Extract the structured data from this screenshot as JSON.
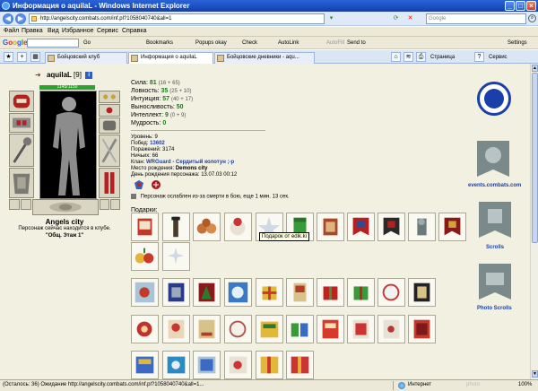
{
  "window": {
    "title": "Информация о aquilaL - Windows Internet Explorer",
    "minimize": "_",
    "maximize": "□",
    "close": "×"
  },
  "address": {
    "url": "http://angelscity.combats.com/inf.pl?1058040740&all=1",
    "search_placeholder": "Google"
  },
  "menu": [
    "Файл",
    "Правка",
    "Вид",
    "Избранное",
    "Сервис",
    "Справка"
  ],
  "google_toolbar": {
    "go": "Go",
    "bookmarks": "Bookmarks",
    "popups": "Popups okay",
    "check": "Check",
    "autolink": "AutoLink",
    "autofill": "AutoFill",
    "sendto": "Send to",
    "settings": "Settings"
  },
  "tabs": [
    {
      "label": "Бойцовский клуб",
      "active": false
    },
    {
      "label": "Информация о aquilaL",
      "active": true
    },
    {
      "label": "Бойцовские дневники - aqu...",
      "active": false
    }
  ],
  "tabbar_right": {
    "page": "Страница",
    "tools": "Сервис"
  },
  "character": {
    "name": "aquilaL",
    "level": "[9]",
    "badge": "i",
    "hp": "1145/1150",
    "city": "Angels city",
    "status": "Персонаж сейчас находится в клубе.",
    "room": "\"Общ. Этаж 1\""
  },
  "stats": [
    {
      "label": "Сила:",
      "value": "81",
      "extra": "(16 + 65)"
    },
    {
      "label": "Ловкость:",
      "value": "35",
      "extra": "(25 + 10)"
    },
    {
      "label": "Интуиция:",
      "value": "57",
      "extra": "(40 + 17)"
    },
    {
      "label": "Выносливость:",
      "value": "50",
      "extra": ""
    },
    {
      "label": "Интеллект:",
      "value": "9",
      "extra": "(0 + 9)"
    },
    {
      "label": "Мудрость:",
      "value": "0",
      "extra": ""
    }
  ],
  "info": {
    "level": "Уровень: 9",
    "wins_label": "Побед:",
    "wins": "13602",
    "losses": "Поражений: 3174",
    "draws": "Ничьих: 66",
    "clan_label": "Клан:",
    "clan": "WRGuard - Сердитый колотун ;-p",
    "birthplace_label": "Место рождения:",
    "birthplace": "Demons city",
    "birthday": "День рождения персонажа: 13.07.03 00:12"
  },
  "weakness": "Персонаж ослаблен из-за смерти в бою, еще 1 мин. 13 сек.",
  "gifts": {
    "title": "Подарки:",
    "tooltip": "Подарок от edik.ki"
  },
  "right_column": {
    "events": "events.combats.com",
    "scrolls": "Scrolls",
    "photo_scrolls": "Photo Scrolls"
  },
  "statusbar": {
    "loading": "(Осталось: 36) Ожидание http://angelscity.combats.com/inf.pl?1058040740&all=1...",
    "zone": "Интернет",
    "zoom": "100%",
    "watermark": "photo"
  },
  "colors": {
    "title_blue": "#1a4fc4",
    "page_bg": "#f2f0e0",
    "stat_green": "#1b7a1b",
    "link_blue": "#1c3fa8",
    "hp_green": "#2da12d"
  }
}
